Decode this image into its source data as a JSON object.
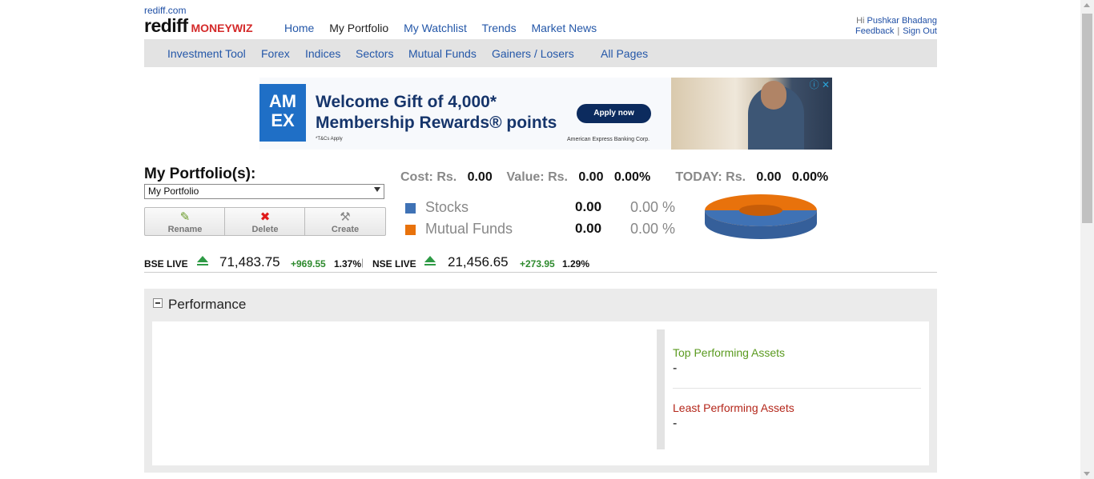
{
  "header": {
    "site_link": "rediff.com",
    "logo_text": "rediff",
    "logo_sub": "MONEYWIZ",
    "nav": [
      "Home",
      "My Portfolio",
      "My Watchlist",
      "Trends",
      "Market News"
    ],
    "active_nav": "My Portfolio",
    "user": {
      "greeting": "Hi",
      "name": "Pushkar Bhadang",
      "feedback": "Feedback",
      "separator": "|",
      "signout": "Sign Out"
    }
  },
  "subnav": [
    "Investment Tool",
    "Forex",
    "Indices",
    "Sectors",
    "Mutual Funds",
    "Gainers / Losers",
    "All Pages"
  ],
  "ad": {
    "brand_mark": "AM EX",
    "headline_1": "Welcome Gift of 4,000*",
    "headline_2": "Membership Rewards® points",
    "tc": "*T&Cs Apply",
    "cta": "Apply now",
    "corp": "American Express Banking Corp.",
    "info": "ⓘ ✕"
  },
  "portfolio": {
    "title": "My Portfolio(s):",
    "selected": "My Portfolio",
    "actions": [
      {
        "label": "Rename",
        "icon": "✎"
      },
      {
        "label": "Delete",
        "icon": "✖"
      },
      {
        "label": "Create",
        "icon": "⚒"
      }
    ],
    "cost_label": "Cost: Rs.",
    "cost": "0.00",
    "value_label": "Value: Rs.",
    "value": "0.00",
    "value_pct": "0.00%",
    "today_label": "TODAY: Rs.",
    "today": "0.00",
    "today_pct": "0.00%",
    "allocation": [
      {
        "name": "Stocks",
        "amount": "0.00",
        "pct": "0.00 %",
        "color": "#3f72b5"
      },
      {
        "name": "Mutual Funds",
        "amount": "0.00",
        "pct": "0.00 %",
        "color": "#e8720c"
      }
    ]
  },
  "ticker": {
    "bse_label": "BSE LIVE",
    "bse": "71,483.75",
    "bse_chg": "+969.55",
    "bse_pct": "1.37%",
    "sep": "|",
    "nse_label": "NSE LIVE",
    "nse": "21,456.65",
    "nse_chg": "+273.95",
    "nse_pct": "1.29%"
  },
  "performance": {
    "title": "Performance",
    "top_label": "Top Performing Assets",
    "top_value": "-",
    "least_label": "Least Performing Assets",
    "least_value": "-",
    "top_color": "#5a9a1f",
    "least_color": "#b4261a"
  }
}
